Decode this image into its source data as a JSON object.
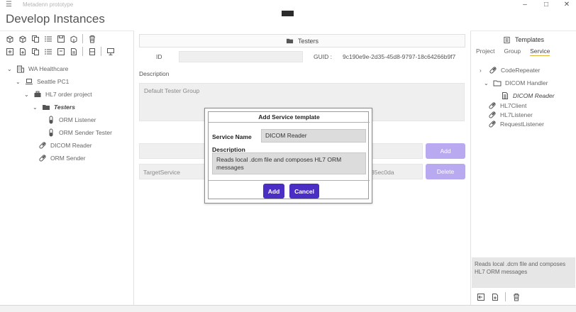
{
  "window": {
    "app_title": "Metadenn prototype",
    "page_title": "Develop Instances"
  },
  "tree": {
    "root": "WA Healthcare",
    "pc": "Seattle PC1",
    "project": "HL7 order project",
    "testers": "Testers",
    "orm_listener": "ORM Listener",
    "orm_sender_tester": "ORM Sender Tester",
    "dicom_reader": "DICOM Reader",
    "orm_sender": "ORM Sender"
  },
  "center": {
    "header": "Testers",
    "id_label": "ID",
    "guid_label": "GUID :",
    "guid_value": "9c190e9e-2d35-45d8-9797-18c64266b9f7",
    "description_label": "Description",
    "description_value": "Default Tester Group",
    "add_label": "Add",
    "delete_label": "Delete",
    "service_row_name": "TargetService",
    "service_row_guid_tail": "35ec0da"
  },
  "dialog": {
    "title": "Add Service template",
    "service_name_label": "Service Name",
    "service_name_value": "DICOM Reader",
    "description_label": "Description",
    "description_value": "Reads local .dcm file and composes HL7 ORM messages",
    "add_label": "Add",
    "cancel_label": "Cancel"
  },
  "templates": {
    "header": "Templates",
    "tabs": [
      "Project",
      "Group",
      "Service"
    ],
    "active_tab": "Service",
    "items": {
      "code_repeater": "CodeRepeater",
      "dicom_handler": "DICOM Handler",
      "dicom_reader": "DICOM Reader",
      "hl7client": "HL7Client",
      "hl7listener": "HL7Listener",
      "request_listener": "RequestListener"
    },
    "description": "Reads local .dcm file and composes HL7 ORM messages"
  },
  "colors": {
    "accent": "#4b2fc4",
    "accent_faded": "#b8a9f0",
    "active_tab_underline": "#e0b33b"
  }
}
